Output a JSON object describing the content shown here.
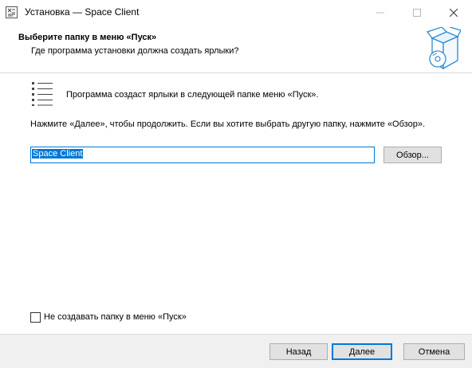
{
  "window": {
    "title": "Установка — Space Client",
    "minimize_icon": "minimize-icon",
    "maximize_icon": "maximize-icon",
    "close_icon": "close-icon"
  },
  "header": {
    "title": "Выберите папку в меню «Пуск»",
    "subtitle": "Где программа установки должна создать ярлыки?",
    "image_icon": "installer-box-disc-icon"
  },
  "main": {
    "list_icon": "list-icon",
    "info": "Программа создаст ярлыки в следующей папке меню «Пуск».",
    "hint": "Нажмите «Далее», чтобы продолжить. Если вы хотите выбрать другую папку, нажмите «Обзор».",
    "folder_value": "Space Client",
    "browse_label": "Обзор...",
    "no_folder_checkbox_label": "Не создавать папку в меню «Пуск»",
    "no_folder_checked": false
  },
  "footer": {
    "back_label": "Назад",
    "next_label": "Далее",
    "cancel_label": "Отмена"
  },
  "colors": {
    "accent": "#0078d7",
    "footer_bg": "#f0f0f0",
    "button_bg": "#e1e1e1"
  }
}
